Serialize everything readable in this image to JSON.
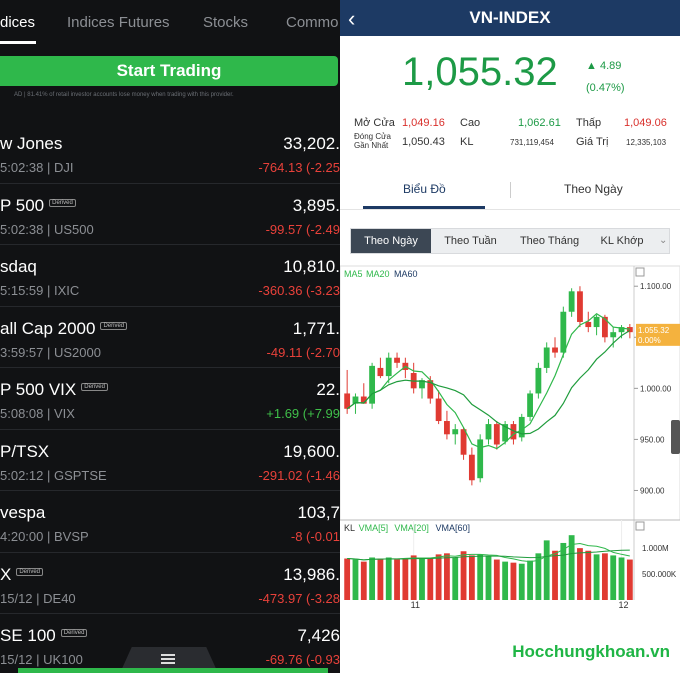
{
  "left": {
    "tabs": [
      "dices",
      "Indices Futures",
      "Stocks",
      "Commo"
    ],
    "start_button": "Start Trading",
    "disclaimer": "AD | 81.41% of retail investor accounts lose money when trading with this provider.",
    "rows": [
      {
        "name": "w Jones",
        "badge": "",
        "time": "5:02:38 | DJI",
        "value": "33,202.",
        "change": "-764.13 (-2.25",
        "sign": "neg"
      },
      {
        "name": "P 500",
        "badge": "Derived",
        "time": "5:02:38 | US500",
        "value": "3,895.",
        "change": "-99.57 (-2.49",
        "sign": "neg"
      },
      {
        "name": "sdaq",
        "badge": "",
        "time": "5:15:59 | IXIC",
        "value": "10,810.",
        "change": "-360.36 (-3.23",
        "sign": "neg"
      },
      {
        "name": "all Cap 2000",
        "badge": "Derived",
        "time": "3:59:57 | US2000",
        "value": "1,771.",
        "change": "-49.11 (-2.70",
        "sign": "neg"
      },
      {
        "name": "P 500 VIX",
        "badge": "Derived",
        "time": "5:08:08 | VIX",
        "value": "22.",
        "change": "+1.69 (+7.99",
        "sign": "pos"
      },
      {
        "name": "P/TSX",
        "badge": "",
        "time": "5:02:12 | GSPTSE",
        "value": "19,600.",
        "change": "-291.02 (-1.46",
        "sign": "neg"
      },
      {
        "name": "vespa",
        "badge": "",
        "time": "4:20:00 | BVSP",
        "value": "103,7",
        "change": "-8 (-0.01",
        "sign": "neg"
      },
      {
        "name": "X",
        "badge": "Derived",
        "time": "15/12 | DE40",
        "value": "13,986.",
        "change": "-473.97 (-3.28",
        "sign": "neg"
      },
      {
        "name": "SE 100",
        "badge": "Derived",
        "time": "15/12 | UK100",
        "value": "7,426",
        "change": "-69.76 (-0.93",
        "sign": "neg"
      }
    ]
  },
  "right": {
    "title": "VN-INDEX",
    "price": "1,055.32",
    "change": "4.89",
    "change_pct": "(0.47%)",
    "stats": {
      "open_label": "Mở Cửa",
      "open": "1,049.16",
      "high_label": "Cao",
      "high": "1,062.61",
      "low_label": "Thấp",
      "low": "1,049.06",
      "prev_close_label_1": "Đóng Cửa",
      "prev_close_label_2": "Gần Nhất",
      "prev_close": "1,050.43",
      "volume_label": "KL",
      "volume": "731,119,454",
      "value_label": "Giá Trị",
      "value": "12,335,103"
    },
    "tabs": [
      "Biểu Đồ",
      "Theo Ngày"
    ],
    "segments": [
      "Theo Ngày",
      "Theo Tuần",
      "Theo Tháng",
      "KL Khớp"
    ],
    "brand": "Hocchungkhoan.vn"
  },
  "chart_data": {
    "type": "candlestick",
    "legend_top": [
      "MA5",
      "MA20",
      "MA60"
    ],
    "legend_bottom": [
      "KL",
      "VMA[5]",
      "VMA[20]",
      "VMA[60]"
    ],
    "y_ticks": [
      "1.100.00",
      "1.050.00",
      "1.000.00",
      "950.00",
      "900.00"
    ],
    "y_tick_values": [
      1100,
      1050,
      1000,
      950,
      900
    ],
    "price_tag": [
      "1.055.32",
      "0.00%"
    ],
    "vol_ticks": [
      "1.000M",
      "500.000K"
    ],
    "vol_tick_values": [
      1000,
      500
    ],
    "x_ticks": [
      {
        "label": "11",
        "index": 8
      },
      {
        "label": "12",
        "index": 33
      }
    ],
    "ylim": [
      875,
      1110
    ],
    "vol_ylim": [
      0,
      1350
    ],
    "colors": {
      "up": "#2fb84b",
      "down": "#e03a32",
      "ma5": "#2fb84b",
      "ma20": "#2fb84b"
    },
    "candles": [
      {
        "o": 995,
        "h": 1018,
        "l": 975,
        "c": 980,
        "v": 800
      },
      {
        "o": 985,
        "h": 995,
        "l": 975,
        "c": 992,
        "v": 780
      },
      {
        "o": 992,
        "h": 1005,
        "l": 985,
        "c": 985,
        "v": 740
      },
      {
        "o": 985,
        "h": 1025,
        "l": 980,
        "c": 1022,
        "v": 820
      },
      {
        "o": 1020,
        "h": 1030,
        "l": 1010,
        "c": 1012,
        "v": 800
      },
      {
        "o": 1012,
        "h": 1035,
        "l": 1005,
        "c": 1030,
        "v": 820
      },
      {
        "o": 1030,
        "h": 1035,
        "l": 1020,
        "c": 1025,
        "v": 780
      },
      {
        "o": 1025,
        "h": 1030,
        "l": 1010,
        "c": 1018,
        "v": 790
      },
      {
        "o": 1015,
        "h": 1025,
        "l": 995,
        "c": 1000,
        "v": 860
      },
      {
        "o": 1000,
        "h": 1010,
        "l": 990,
        "c": 1008,
        "v": 800
      },
      {
        "o": 1008,
        "h": 1012,
        "l": 985,
        "c": 990,
        "v": 820
      },
      {
        "o": 990,
        "h": 998,
        "l": 965,
        "c": 968,
        "v": 880
      },
      {
        "o": 968,
        "h": 978,
        "l": 950,
        "c": 955,
        "v": 900
      },
      {
        "o": 955,
        "h": 965,
        "l": 945,
        "c": 960,
        "v": 820
      },
      {
        "o": 960,
        "h": 962,
        "l": 930,
        "c": 935,
        "v": 940
      },
      {
        "o": 935,
        "h": 942,
        "l": 905,
        "c": 910,
        "v": 860
      },
      {
        "o": 912,
        "h": 955,
        "l": 908,
        "c": 950,
        "v": 880
      },
      {
        "o": 950,
        "h": 970,
        "l": 945,
        "c": 965,
        "v": 840
      },
      {
        "o": 965,
        "h": 968,
        "l": 940,
        "c": 945,
        "v": 780
      },
      {
        "o": 948,
        "h": 968,
        "l": 945,
        "c": 965,
        "v": 740
      },
      {
        "o": 965,
        "h": 968,
        "l": 945,
        "c": 950,
        "v": 720
      },
      {
        "o": 952,
        "h": 975,
        "l": 948,
        "c": 972,
        "v": 700
      },
      {
        "o": 972,
        "h": 998,
        "l": 968,
        "c": 995,
        "v": 760
      },
      {
        "o": 995,
        "h": 1025,
        "l": 990,
        "c": 1020,
        "v": 900
      },
      {
        "o": 1020,
        "h": 1045,
        "l": 1015,
        "c": 1040,
        "v": 1150
      },
      {
        "o": 1040,
        "h": 1050,
        "l": 1030,
        "c": 1035,
        "v": 950
      },
      {
        "o": 1035,
        "h": 1080,
        "l": 1030,
        "c": 1075,
        "v": 1100
      },
      {
        "o": 1075,
        "h": 1098,
        "l": 1070,
        "c": 1095,
        "v": 1250
      },
      {
        "o": 1095,
        "h": 1100,
        "l": 1060,
        "c": 1065,
        "v": 1000
      },
      {
        "o": 1065,
        "h": 1075,
        "l": 1055,
        "c": 1060,
        "v": 950
      },
      {
        "o": 1060,
        "h": 1072,
        "l": 1052,
        "c": 1070,
        "v": 880
      },
      {
        "o": 1070,
        "h": 1072,
        "l": 1045,
        "c": 1050,
        "v": 900
      },
      {
        "o": 1050,
        "h": 1060,
        "l": 1040,
        "c": 1055,
        "v": 860
      },
      {
        "o": 1055,
        "h": 1062,
        "l": 1049,
        "c": 1060,
        "v": 820
      },
      {
        "o": 1060,
        "h": 1063,
        "l": 1049,
        "c": 1055,
        "v": 780
      }
    ]
  }
}
